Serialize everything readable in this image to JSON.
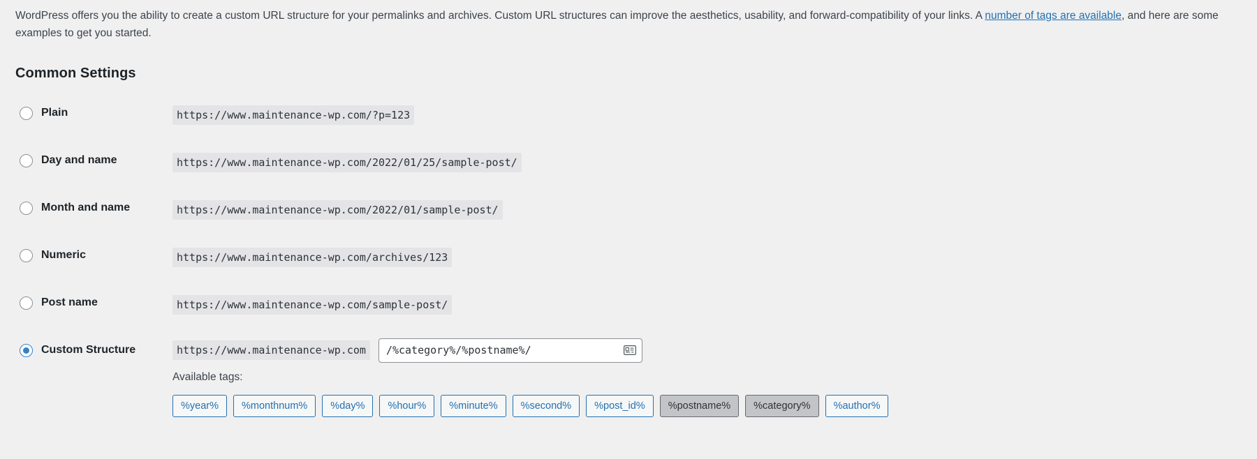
{
  "intro": {
    "text_before_link": "WordPress offers you the ability to create a custom URL structure for your permalinks and archives. Custom URL structures can improve the aesthetics, usability, and forward-compatibility of your links. A ",
    "link_text": "number of tags are available",
    "text_after_link": ", and here are some examples to get you started."
  },
  "section": {
    "heading": "Common Settings"
  },
  "options": [
    {
      "id": "plain",
      "label": "Plain",
      "example": "https://www.maintenance-wp.com/?p=123",
      "selected": false
    },
    {
      "id": "day-and-name",
      "label": "Day and name",
      "example": "https://www.maintenance-wp.com/2022/01/25/sample-post/",
      "selected": false
    },
    {
      "id": "month-and-name",
      "label": "Month and name",
      "example": "https://www.maintenance-wp.com/2022/01/sample-post/",
      "selected": false
    },
    {
      "id": "numeric",
      "label": "Numeric",
      "example": "https://www.maintenance-wp.com/archives/123",
      "selected": false
    },
    {
      "id": "post-name",
      "label": "Post name",
      "example": "https://www.maintenance-wp.com/sample-post/",
      "selected": false
    }
  ],
  "custom_structure": {
    "label": "Custom Structure",
    "base_url": "https://www.maintenance-wp.com",
    "input_value": "/%category%/%postname%/",
    "input_placeholder": "",
    "selected": true,
    "autofill_icon": "contact-card-icon"
  },
  "available_tags": {
    "label": "Available tags:",
    "tags": [
      {
        "label": "%year%",
        "in_use": false
      },
      {
        "label": "%monthnum%",
        "in_use": false
      },
      {
        "label": "%day%",
        "in_use": false
      },
      {
        "label": "%hour%",
        "in_use": false
      },
      {
        "label": "%minute%",
        "in_use": false
      },
      {
        "label": "%second%",
        "in_use": false
      },
      {
        "label": "%post_id%",
        "in_use": false
      },
      {
        "label": "%postname%",
        "in_use": true
      },
      {
        "label": "%category%",
        "in_use": true
      },
      {
        "label": "%author%",
        "in_use": false
      }
    ]
  },
  "colors": {
    "page_background": "#f0f0f1",
    "link": "#2271b1",
    "radio_accent": "#3582c4",
    "code_background": "#e4e4e7",
    "tag_in_use_background": "#c3c4c7"
  }
}
